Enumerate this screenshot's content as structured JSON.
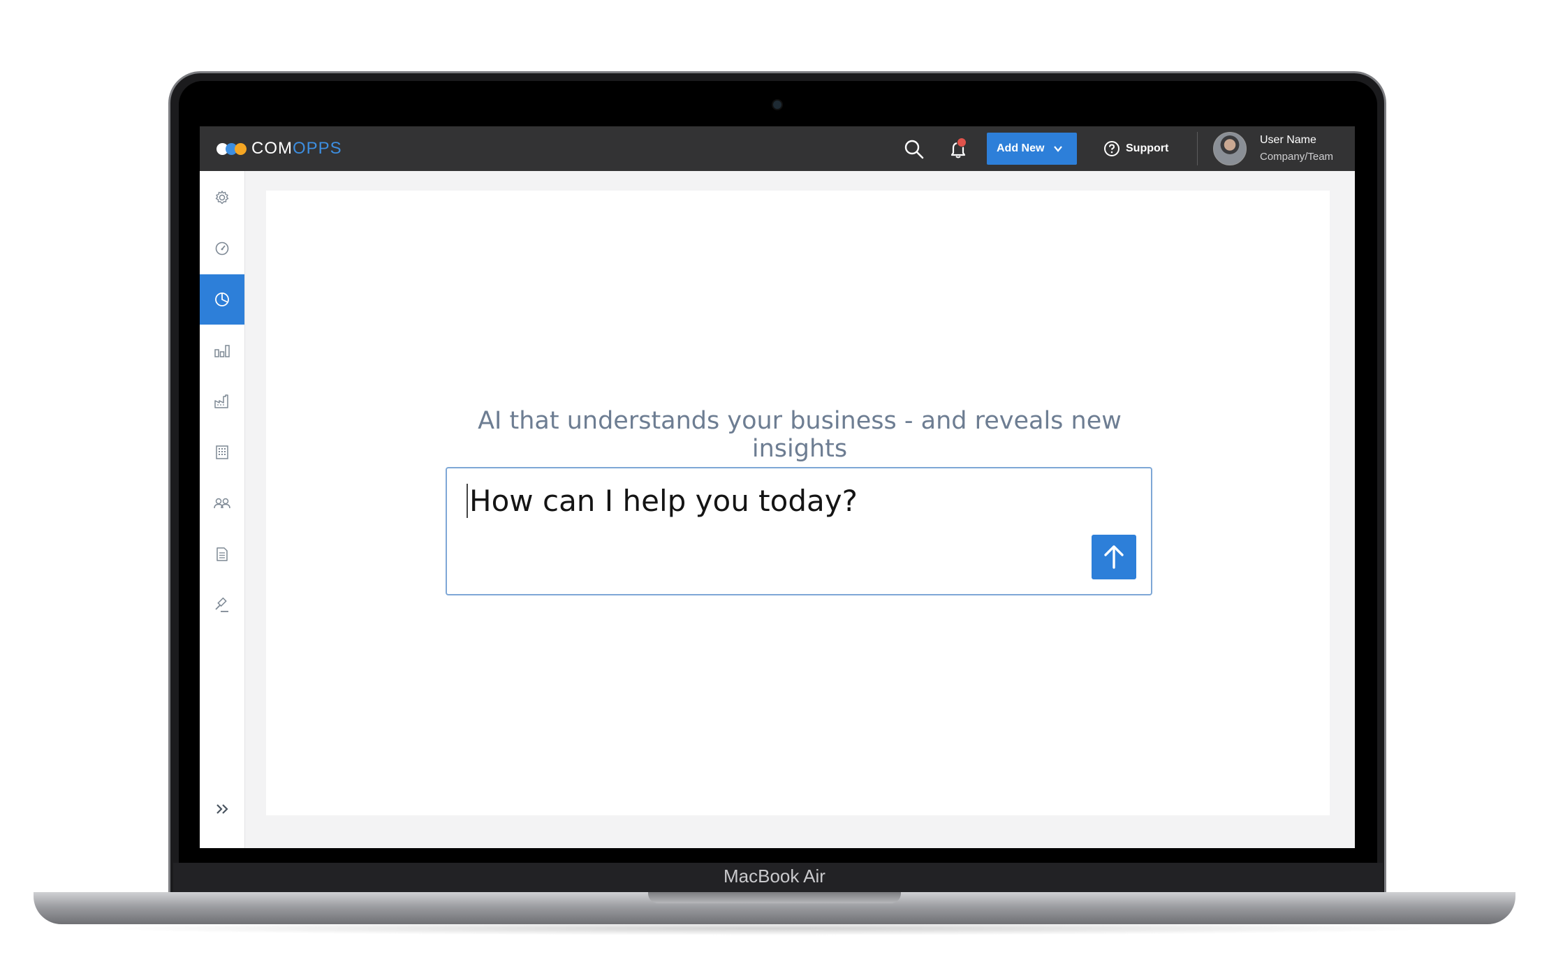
{
  "device": {
    "label": "MacBook Air"
  },
  "app": {
    "logo": {
      "part1": "COM",
      "part2": "OPPS",
      "dot_colors": [
        "#ffffff",
        "#3d8ee0",
        "#f5a623"
      ]
    },
    "topbar": {
      "search_icon": "search-icon",
      "notifications_icon": "bell-icon",
      "notification_badge_color": "#e0534b",
      "add_new_label": "Add New",
      "support_label": "Support",
      "user_name": "User Name",
      "user_team": "Company/Team"
    },
    "sidebar": {
      "items": [
        {
          "icon": "gear-icon",
          "active": false
        },
        {
          "icon": "speedometer-icon",
          "active": false
        },
        {
          "icon": "pie-chart-icon",
          "active": true
        },
        {
          "icon": "bar-chart-icon",
          "active": false
        },
        {
          "icon": "factory-icon",
          "active": false
        },
        {
          "icon": "building-icon",
          "active": false
        },
        {
          "icon": "users-icon",
          "active": false
        },
        {
          "icon": "document-icon",
          "active": false
        },
        {
          "icon": "gavel-icon",
          "active": false
        }
      ],
      "expand_icon": "double-chevron-right-icon"
    },
    "main": {
      "headline": "AI that understands your business - and reveals new insights",
      "prompt_text": "How can I help you today?",
      "send_icon": "arrow-up-icon"
    },
    "colors": {
      "accent": "#2d7fd9",
      "topbar": "#333334",
      "headline": "#6d7d92"
    }
  }
}
